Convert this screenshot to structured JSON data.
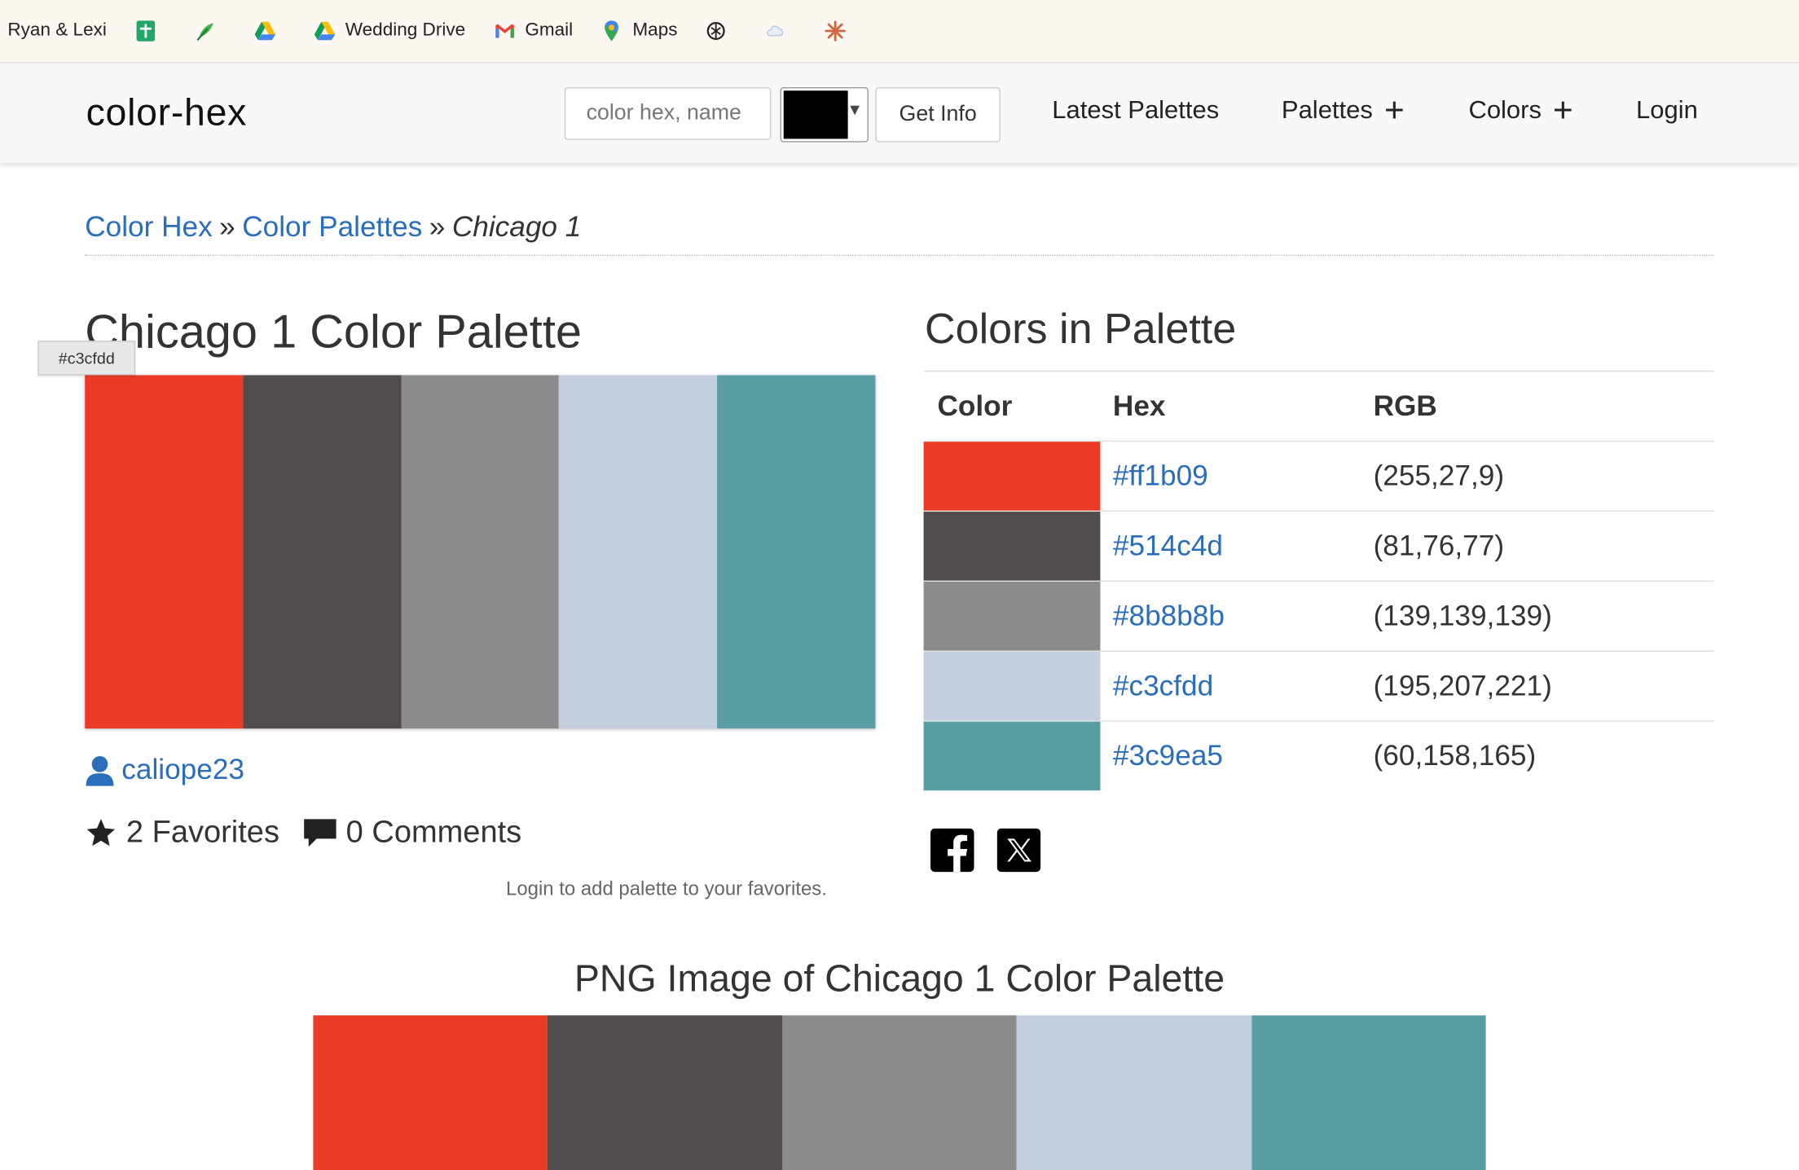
{
  "bookmarks": [
    {
      "label": "Ryan & Lexi",
      "icon": "bookmark-chevron-icon"
    },
    {
      "label": "",
      "icon": "sheets-icon"
    },
    {
      "label": "",
      "icon": "feather-icon"
    },
    {
      "label": "",
      "icon": "drive-icon"
    },
    {
      "label": "Wedding Drive",
      "icon": "drive-icon"
    },
    {
      "label": "Gmail",
      "icon": "gmail-icon"
    },
    {
      "label": "Maps",
      "icon": "maps-icon"
    },
    {
      "label": "",
      "icon": "openai-icon"
    },
    {
      "label": "",
      "icon": "cloud-icon"
    },
    {
      "label": "",
      "icon": "claude-icon"
    }
  ],
  "navbar": {
    "brand": "color-hex",
    "search_placeholder": "color hex, name",
    "picker_color": "#000000",
    "get_info": "Get Info",
    "links": {
      "latest": "Latest Palettes",
      "palettes": "Palettes",
      "colors": "Colors",
      "login": "Login"
    }
  },
  "breadcrumb": {
    "home": "Color Hex",
    "sep": "»",
    "palettes": "Color Palettes",
    "current": "Chicago 1"
  },
  "palette": {
    "title": "Chicago 1 Color Palette",
    "tooltip": "#c3cfdd",
    "colors": [
      "#ea3b26",
      "#514c4d",
      "#8b8b8b",
      "#c3cfdd",
      "#589ea3"
    ],
    "author": "caliope23",
    "favorites": "2 Favorites",
    "comments": "0 Comments",
    "login_note": "Login to add palette to your favorites."
  },
  "colors_table": {
    "title": "Colors in Palette",
    "headers": {
      "color": "Color",
      "hex": "Hex",
      "rgb": "RGB"
    },
    "rows": [
      {
        "hex": "#ff1b09",
        "rgb": "(255,27,9)",
        "swatch": "#ea3b26"
      },
      {
        "hex": "#514c4d",
        "rgb": "(81,76,77)",
        "swatch": "#514c4d"
      },
      {
        "hex": "#8b8b8b",
        "rgb": "(139,139,139)",
        "swatch": "#8b8b8b"
      },
      {
        "hex": "#c3cfdd",
        "rgb": "(195,207,221)",
        "swatch": "#c3cfdd"
      },
      {
        "hex": "#3c9ea5",
        "rgb": "(60,158,165)",
        "swatch": "#589ea3"
      }
    ]
  },
  "png_section": {
    "title": "PNG Image of Chicago 1 Color Palette"
  }
}
